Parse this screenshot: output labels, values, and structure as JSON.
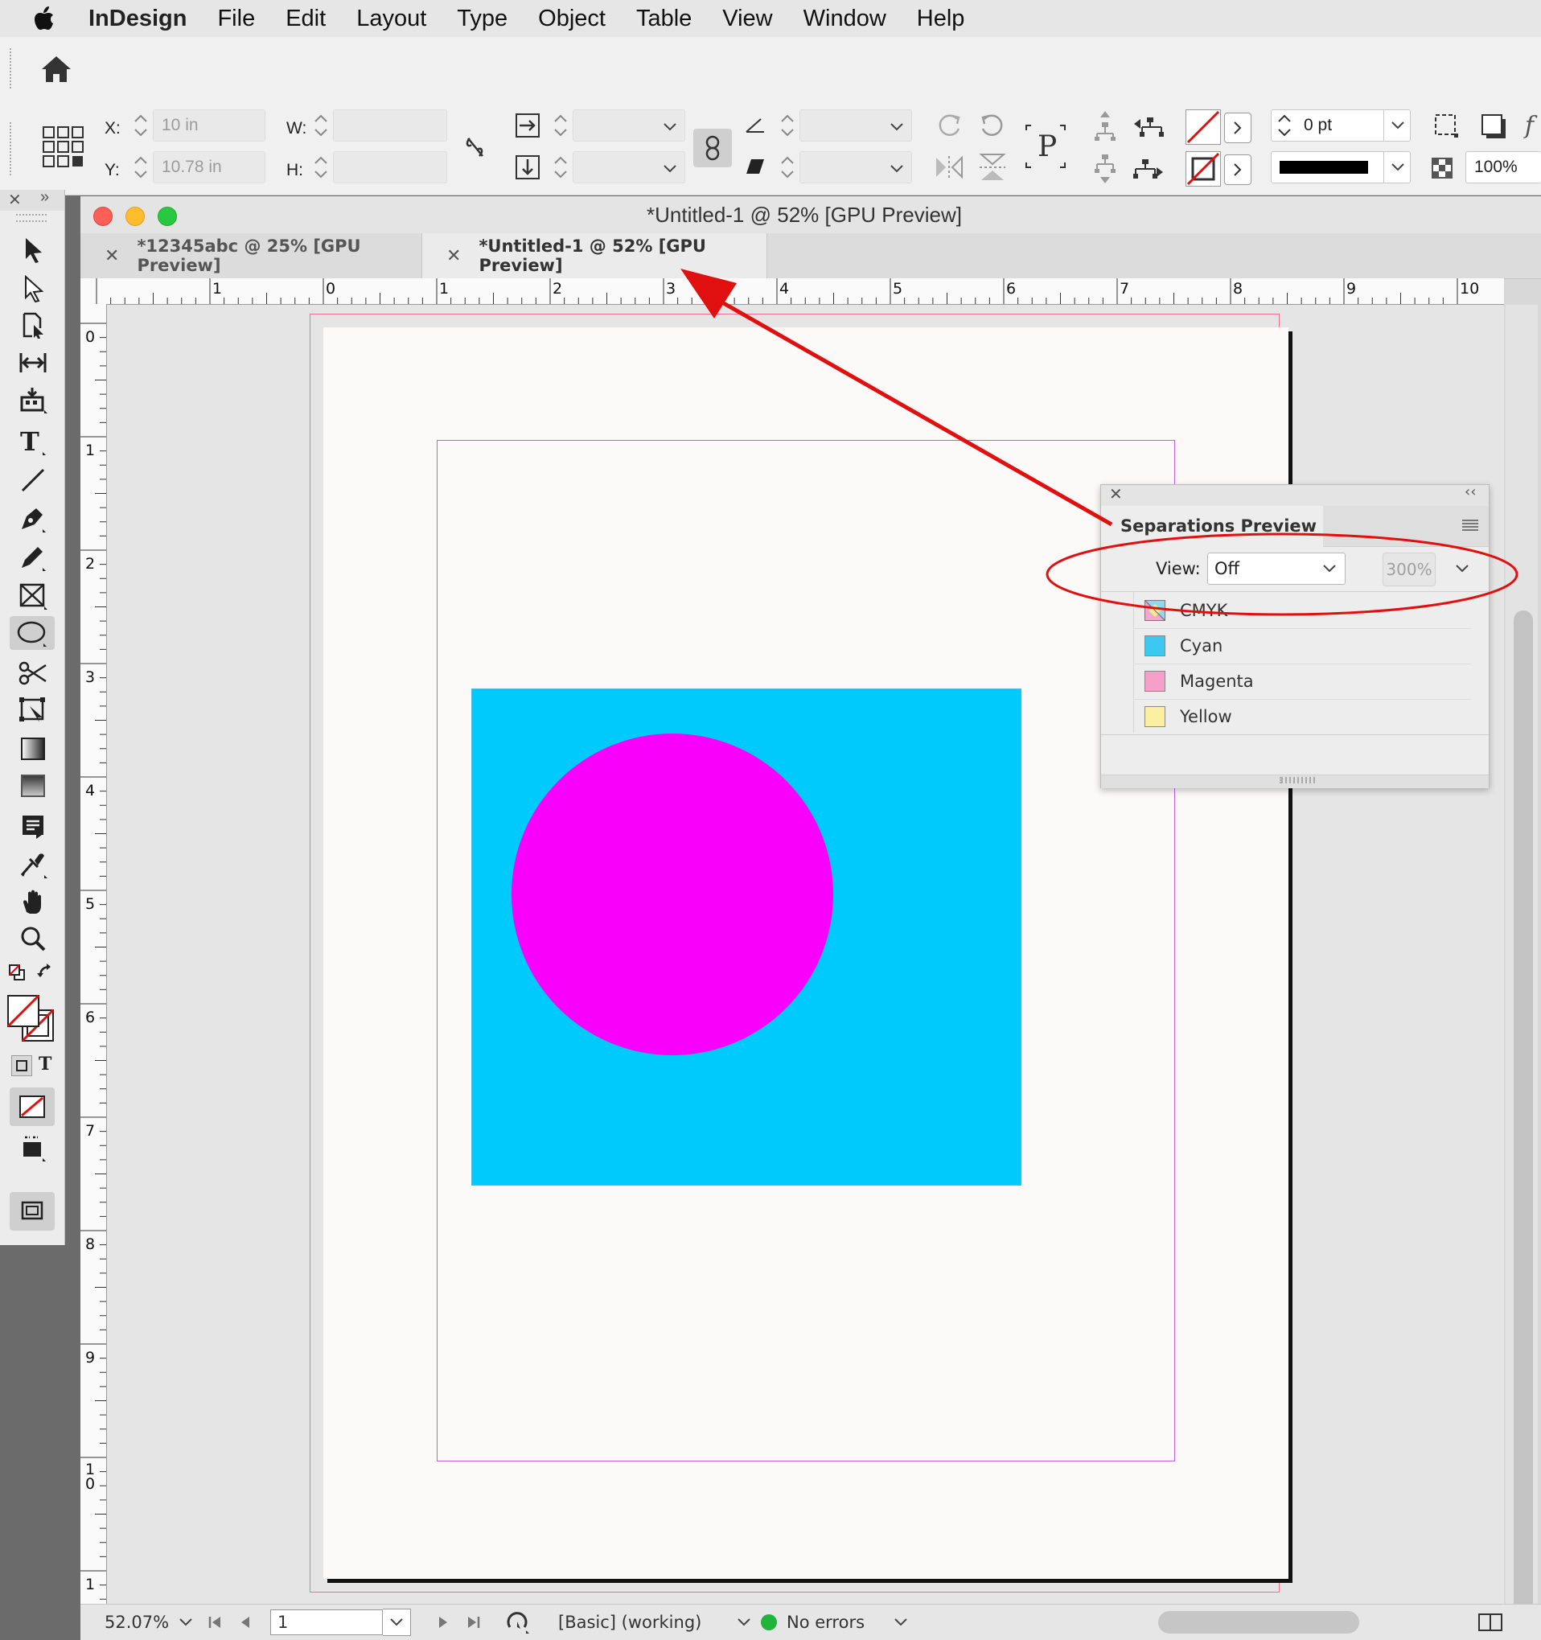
{
  "menubar": {
    "app_name": "InDesign",
    "items": [
      "File",
      "Edit",
      "Layout",
      "Type",
      "Object",
      "Table",
      "View",
      "Window",
      "Help"
    ]
  },
  "control_panel": {
    "x_label": "X:",
    "x_value": "10 in",
    "y_label": "Y:",
    "y_value": "10.78 in",
    "w_label": "W:",
    "h_label": "H:",
    "stroke_weight": "0 pt",
    "opacity": "100%"
  },
  "document": {
    "window_title": "*Untitled-1 @ 52% [GPU Preview]",
    "tabs": [
      {
        "label": "*12345abc @ 25% [GPU Preview]",
        "active": false
      },
      {
        "label": "*Untitled-1 @ 52% [GPU Preview]",
        "active": true
      }
    ],
    "ruler_h_labels": [
      "1",
      "0",
      "1",
      "2",
      "3",
      "4",
      "5",
      "6",
      "7",
      "8",
      "9",
      "10"
    ],
    "ruler_v_labels": [
      "0",
      "1",
      "2",
      "3",
      "4",
      "5",
      "6",
      "7",
      "8",
      "9",
      "1\n0",
      "1"
    ],
    "shape_colors": {
      "rectangle": "#00c9fc",
      "ellipse": "#f800fa"
    }
  },
  "status": {
    "zoom": "52.07%",
    "page": "1",
    "preflight_profile": "[Basic] (working)",
    "errors": "No errors"
  },
  "separations_panel": {
    "title": "Separations Preview",
    "view_label": "View:",
    "view_value": "Off",
    "ink_limit": "300%",
    "inks": [
      {
        "name": "CMYK",
        "color": "composite"
      },
      {
        "name": "Cyan",
        "color": "#3cc8f0"
      },
      {
        "name": "Magenta",
        "color": "#f5a0c8"
      },
      {
        "name": "Yellow",
        "color": "#fbf0a0"
      }
    ]
  },
  "annotation": {
    "arrow_color": "#e01010"
  }
}
